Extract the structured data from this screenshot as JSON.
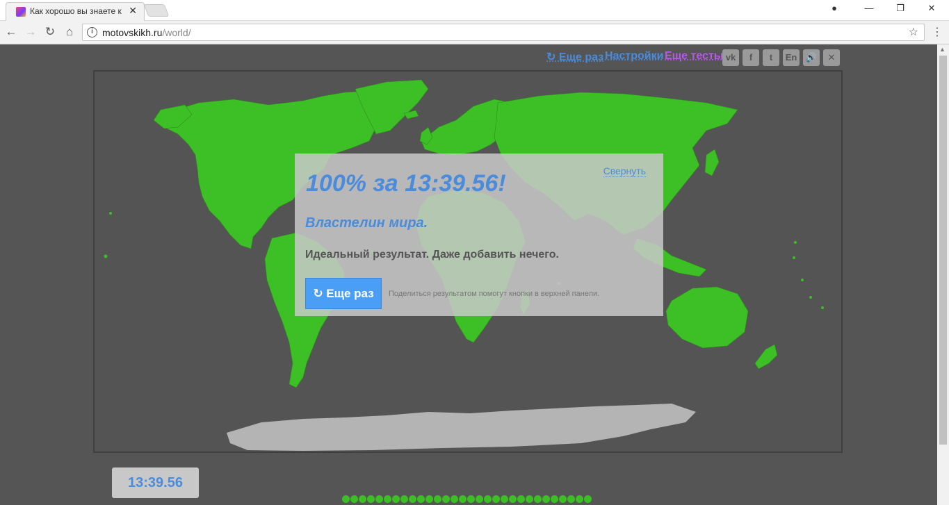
{
  "browser": {
    "tab_title": "Как хорошо вы знаете к",
    "url_host": "motovskikh.ru",
    "url_path": "/world/"
  },
  "top_links": {
    "again": "↻ Еще раз",
    "settings": "Настройки",
    "more_tests": "Еще тесты"
  },
  "social": {
    "vk": "vk",
    "facebook": "f",
    "twitter": "t",
    "lang": "En",
    "sound": "🔊",
    "close": "✕"
  },
  "result": {
    "title": "100% за 13:39.56!",
    "collapse": "Свернуть",
    "rank": "Властелин мира.",
    "description": "Идеальный результат. Даже добавить нечего.",
    "again_button": "↻ Еще раз",
    "share_hint": "Поделиться результатом помогут кнопки в верхней панели."
  },
  "timer": "13:39.56",
  "colors": {
    "land_done": "#3dbf26",
    "antarctica": "#b4b4b4",
    "accent_blue": "#4a8cdb",
    "purple_link": "#b659e6"
  },
  "progress_dots_count": 30
}
